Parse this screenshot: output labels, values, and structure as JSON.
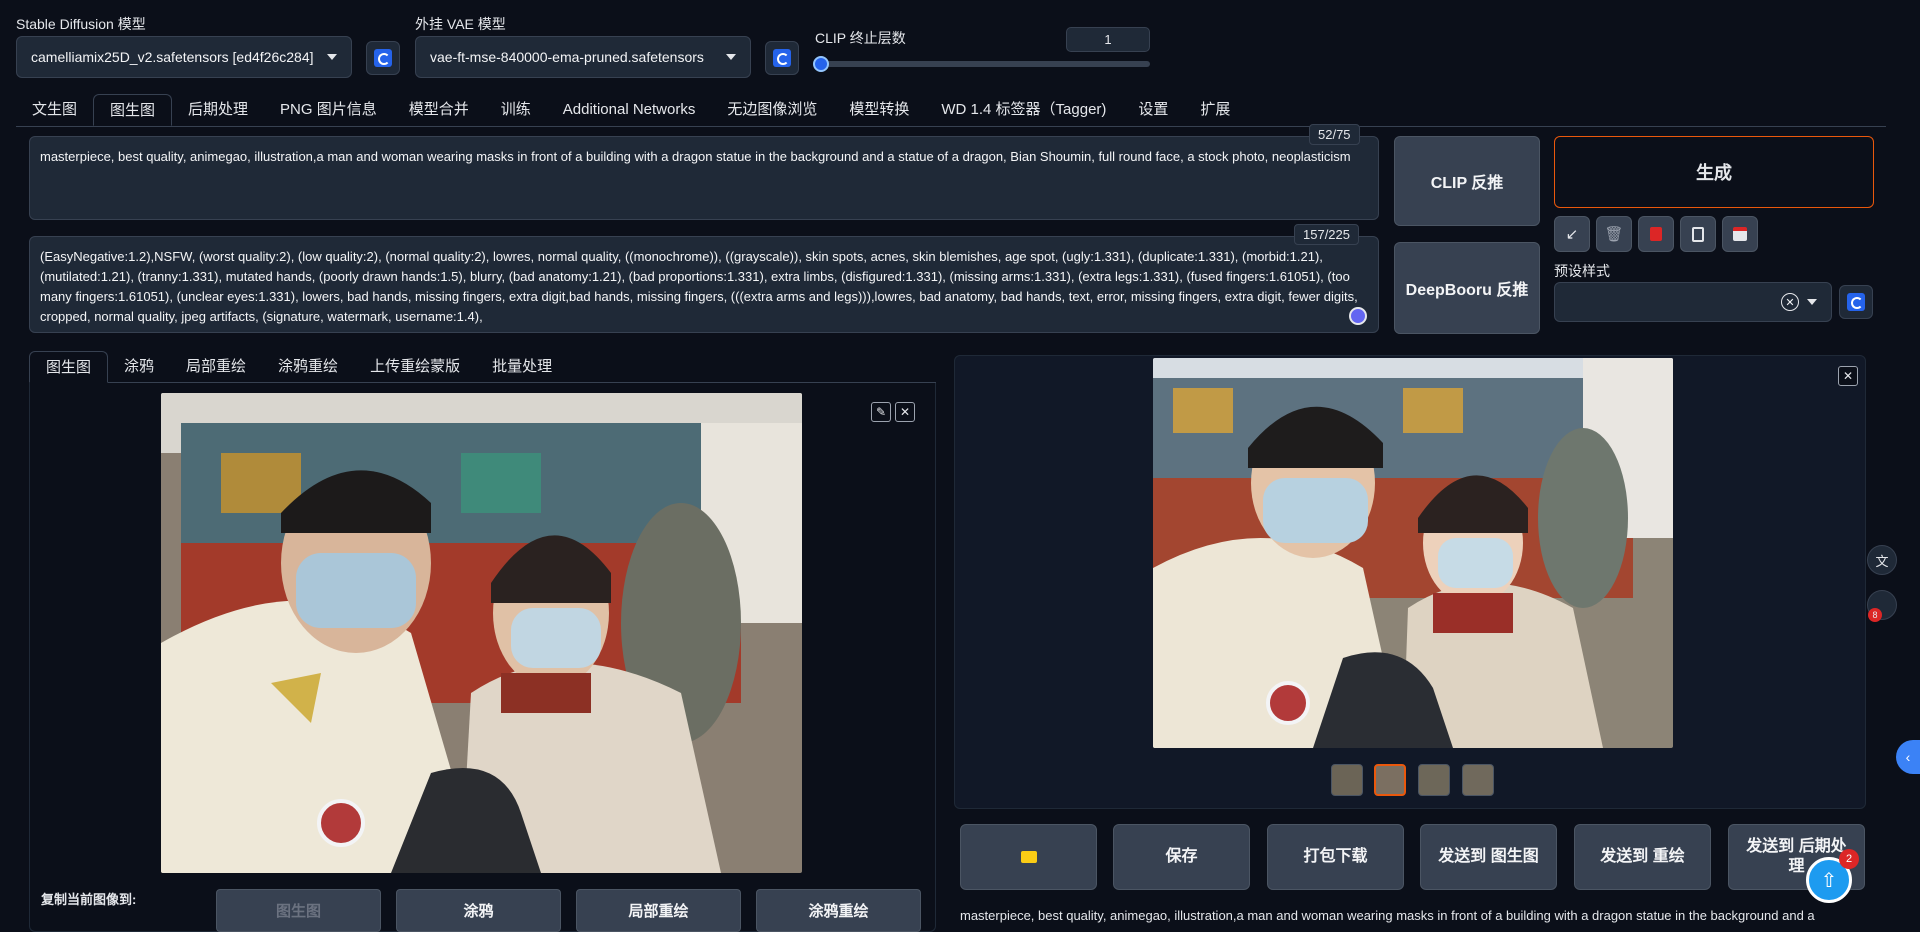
{
  "top": {
    "sd_model_label": "Stable Diffusion 模型",
    "sd_model_value": "camelliamix25D_v2.safetensors [ed4f26c284]",
    "vae_label": "外挂 VAE 模型",
    "vae_value": "vae-ft-mse-840000-ema-pruned.safetensors",
    "clip_label": "CLIP 终止层数",
    "clip_value": "1",
    "clip_slider_fraction": 0.0
  },
  "main_tabs": [
    "文生图",
    "图生图",
    "后期处理",
    "PNG 图片信息",
    "模型合并",
    "训练",
    "Additional Networks",
    "无边图像浏览",
    "模型转换",
    "WD 1.4 标签器（Tagger)",
    "设置",
    "扩展"
  ],
  "main_tab_active": "图生图",
  "prompt": {
    "text": "masterpiece, best quality, animegao, illustration,a man and woman wearing masks in front of a building with a dragon statue in the background and a statue of a dragon, Bian Shoumin, full round face, a stock photo, neoplasticism",
    "counter": "52/75"
  },
  "negative": {
    "text": "(EasyNegative:1.2),NSFW, (worst quality:2), (low quality:2), (normal quality:2), lowres, normal quality, ((monochrome)), ((grayscale)), skin spots, acnes, skin blemishes, age spot, (ugly:1.331), (duplicate:1.331), (morbid:1.21), (mutilated:1.21), (tranny:1.331), mutated hands, (poorly drawn hands:1.5), blurry, (bad anatomy:1.21), (bad proportions:1.331), extra limbs, (disfigured:1.331), (missing arms:1.331), (extra legs:1.331), (fused fingers:1.61051), (too many fingers:1.61051), (unclear eyes:1.331), lowers, bad hands, missing fingers, extra digit,bad hands, missing fingers, (((extra arms and legs))),lowres, bad anatomy, bad hands, text, error, missing fingers, extra digit, fewer digits, cropped, normal quality, jpeg artifacts, (signature, watermark, username:1.4),",
    "counter": "157/225"
  },
  "buttons": {
    "clip_interrogate": "CLIP 反推",
    "deepbooru": "DeepBooru 反推",
    "generate": "生成",
    "style_label": "预设样式",
    "icons": [
      "arrow-icon",
      "trash-icon",
      "red-card-icon",
      "clipboard-icon",
      "save-icon"
    ]
  },
  "sub_tabs": [
    "图生图",
    "涂鸦",
    "局部重绘",
    "涂鸦重绘",
    "上传重绘蒙版",
    "批量处理"
  ],
  "sub_tab_active": "图生图",
  "copy_to": {
    "label": "复制当前图像到:",
    "buttons": [
      "图生图",
      "涂鸦",
      "局部重绘",
      "涂鸦重绘"
    ]
  },
  "output": {
    "actions": [
      "保存",
      "打包下载",
      "发送到 图生图",
      "发送到 重绘",
      "发送到 后期处理"
    ],
    "caption": "masterpiece, best quality, animegao, illustration,a man and woman wearing masks in front of a building with a dragon statue in the background and a",
    "thumb_count": 4,
    "selected_thumb": 2
  },
  "float": {
    "badge_8": "8",
    "badge_2": "2"
  }
}
